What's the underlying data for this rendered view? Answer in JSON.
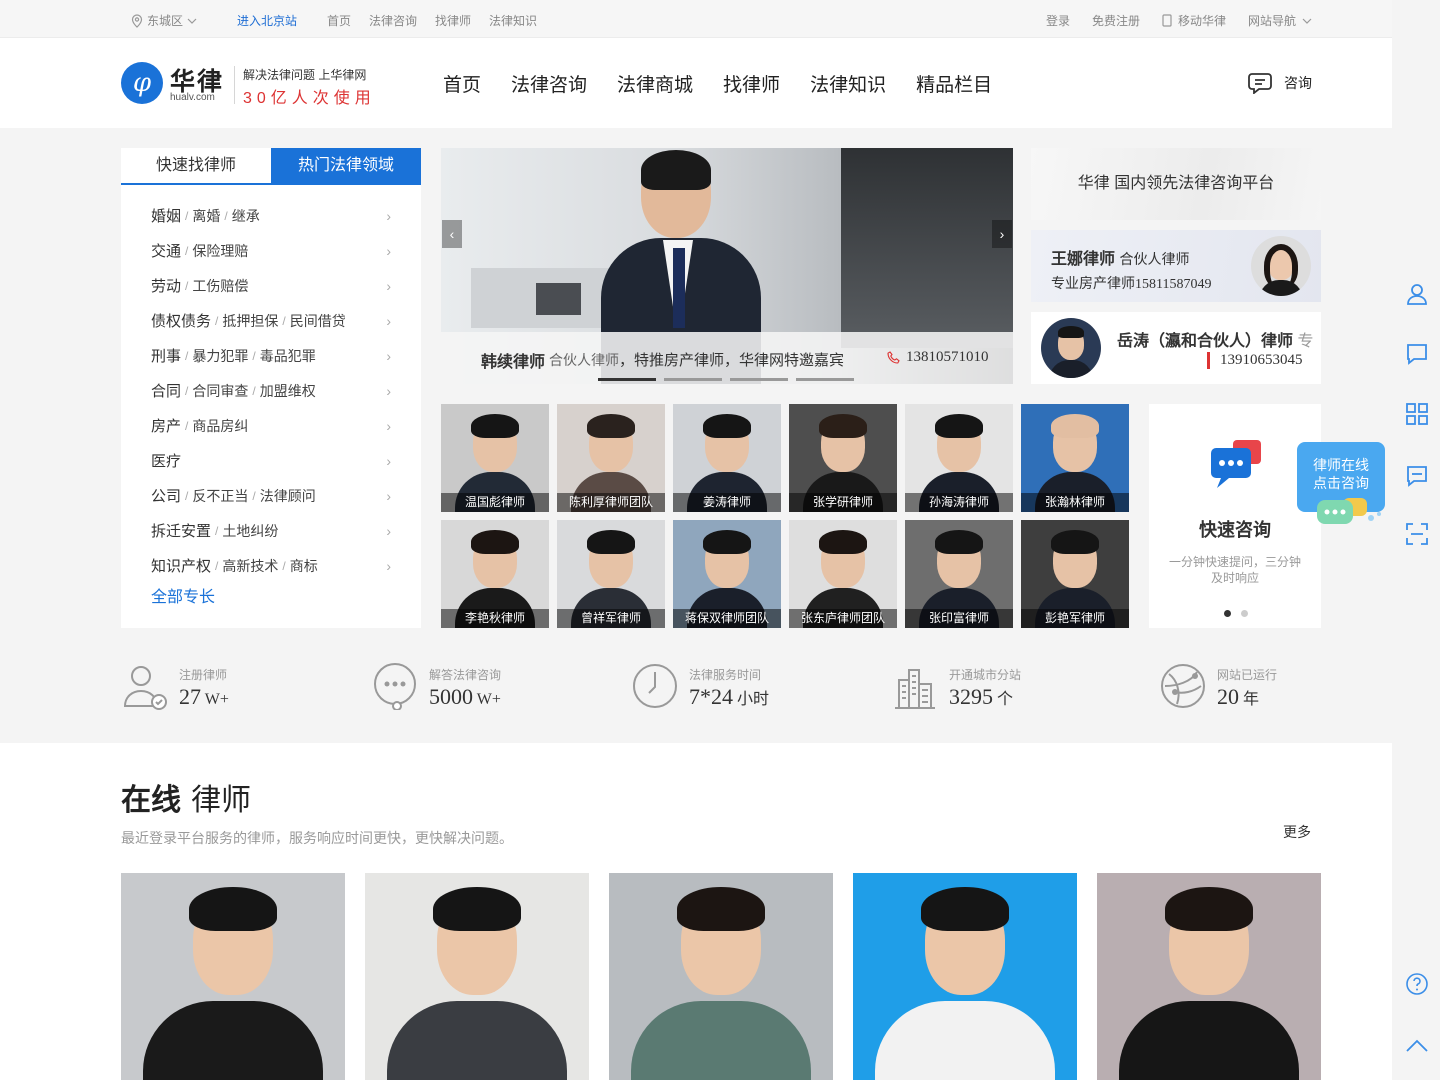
{
  "topbar": {
    "location": "东城区",
    "city_link": "进入北京站",
    "links": [
      "首页",
      "法律咨询",
      "找律师",
      "法律知识"
    ],
    "login": "登录",
    "register": "免费注册",
    "mobile": "移动华律",
    "site_nav": "网站导航"
  },
  "header": {
    "logo_glyph": "φ",
    "logo_name": "华律",
    "logo_domain": "hualv.com",
    "slogan_line1": "解决法律问题 上华律网",
    "slogan_line2": "30亿人次使用",
    "nav": [
      "首页",
      "法律咨询",
      "法律商城",
      "找律师",
      "法律知识",
      "精品栏目"
    ],
    "consult": "咨询"
  },
  "categories": {
    "tabs": [
      "快速找律师",
      "热门法律领域"
    ],
    "active_tab": 1,
    "items": [
      {
        "main": "婚姻",
        "subs": [
          "离婚",
          "继承"
        ]
      },
      {
        "main": "交通",
        "subs": [
          "保险理赔"
        ]
      },
      {
        "main": "劳动",
        "subs": [
          "工伤赔偿"
        ]
      },
      {
        "main": "债权债务",
        "subs": [
          "抵押担保",
          "民间借贷"
        ]
      },
      {
        "main": "刑事",
        "subs": [
          "暴力犯罪",
          "毒品犯罪"
        ]
      },
      {
        "main": "合同",
        "subs": [
          "合同审查",
          "加盟维权"
        ]
      },
      {
        "main": "房产",
        "subs": [
          "商品房纠"
        ]
      },
      {
        "main": "医疗",
        "subs": []
      },
      {
        "main": "公司",
        "subs": [
          "反不正当",
          "法律顾问"
        ]
      },
      {
        "main": "拆迁安置",
        "subs": [
          "土地纠纷"
        ]
      },
      {
        "main": "知识产权",
        "subs": [
          "高新技术",
          "商标"
        ]
      }
    ],
    "all_link": "全部专长"
  },
  "banner": {
    "name": "韩续律师",
    "role": "合伙人律师",
    "desc": "，特推房产律师，华律网特邀嘉宾",
    "phone": "13810571010",
    "slides": 4,
    "active_slide": 0
  },
  "promos": {
    "p1": "华律 国内领先法律咨询平台",
    "p2_name": "王娜律师",
    "p2_role": "合伙人律师",
    "p2_desc": "专业房产律师15811587049",
    "p3_name": "岳涛（瀛和合伙人）律师",
    "p3_more": "专",
    "p3_phone": "13910653045"
  },
  "lawyers": [
    {
      "label": "温国彪律师",
      "bg": "#c9c9c9",
      "suit": "#222a36",
      "hair": "#151515"
    },
    {
      "label": "陈利厚律师团队",
      "bg": "#d7d1cd",
      "suit": "#5a4b45",
      "hair": "#2a221e"
    },
    {
      "label": "姜涛律师",
      "bg": "#cfd2d6",
      "suit": "#1e2430",
      "hair": "#151515"
    },
    {
      "label": "张学研律师",
      "bg": "#4e4e4e",
      "suit": "#191919",
      "hair": "#2b1f18"
    },
    {
      "label": "孙海涛律师",
      "bg": "#e4e4e4",
      "suit": "#1a1f2a",
      "hair": "#151515"
    },
    {
      "label": "张瀚林律师",
      "bg": "#2f6fb8",
      "suit": "#1a1f2a",
      "hair": "#e2bea2"
    },
    {
      "label": "李艳秋律师",
      "bg": "#d8d8d8",
      "suit": "#1a1a1a",
      "hair": "#1c1512"
    },
    {
      "label": "曾祥军律师",
      "bg": "#d9dadc",
      "suit": "#2a2e36",
      "hair": "#151515"
    },
    {
      "label": "蒋保双律师团队",
      "bg": "#8fa6bd",
      "suit": "#1a1f2a",
      "hair": "#151515"
    },
    {
      "label": "张东庐律师团队",
      "bg": "#dedede",
      "suit": "#202020",
      "hair": "#1c1512"
    },
    {
      "label": "张印富律师",
      "bg": "#6e6e6e",
      "suit": "#1a1f2a",
      "hair": "#151515"
    },
    {
      "label": "彭艳军律师",
      "bg": "#3e3e3e",
      "suit": "#1a1f2a",
      "hair": "#151515"
    }
  ],
  "quick": {
    "title": "快速咨询",
    "desc": "一分钟快速提问，三分钟及时响应",
    "pages": 2,
    "active_page": 0
  },
  "bubble": {
    "line1": "律师在线",
    "line2": "点击咨询"
  },
  "stats": [
    {
      "label": "注册律师",
      "value": "27",
      "unit": "W+",
      "icon": "lawyer-icon"
    },
    {
      "label": "解答法律咨询",
      "value": "5000",
      "unit": "W+",
      "icon": "chat-icon"
    },
    {
      "label": "法律服务时间",
      "value": "7*24",
      "unit": "小时",
      "icon": "clock-icon"
    },
    {
      "label": "开通城市分站",
      "value": "3295",
      "unit": "个",
      "icon": "city-icon"
    },
    {
      "label": "网站已运行",
      "value": "20",
      "unit": "年",
      "icon": "globe-icon"
    }
  ],
  "online": {
    "title_bold": "在线",
    "title_rest": "律师",
    "subtitle": "最近登录平台服务的律师，服务响应时间更快，更快解决问题。",
    "more": "更多",
    "cards": [
      {
        "bg": "#c7c9cc",
        "suit": "#1a1a1a",
        "hair": "#151515"
      },
      {
        "bg": "#e6e6e4",
        "suit": "#3a3d42",
        "hair": "#151515"
      },
      {
        "bg": "#b8bcc0",
        "suit": "#5a7a72",
        "hair": "#1c1512"
      },
      {
        "bg": "#1f9ee8",
        "suit": "#f2f2f2",
        "hair": "#151515"
      },
      {
        "bg": "#b9aeb1",
        "suit": "#161616",
        "hair": "#1c1512"
      }
    ]
  },
  "colors": {
    "accent": "#1a72d8",
    "slogan": "#dd3333",
    "bubble": "#4aa8f0"
  }
}
